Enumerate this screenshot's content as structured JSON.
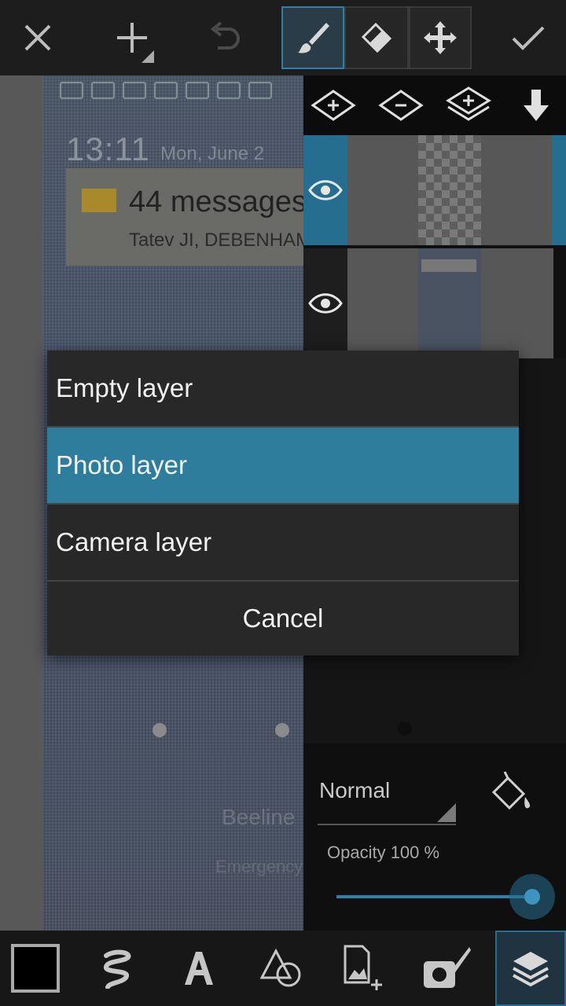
{
  "top_toolbar": {
    "icons": [
      "close-icon",
      "add-icon",
      "undo-icon",
      "brush-icon",
      "eraser-icon",
      "move-icon",
      "check-icon"
    ],
    "active_tool": "brush"
  },
  "canvas_photo": {
    "time": "13:11",
    "date": "Mon, June 2",
    "notification_title": "44 messages",
    "notification_sub": "Tatev JI, DEBENHAMS, ",
    "carrier": "Beeline",
    "emergency": "Emergency calls only"
  },
  "layers_panel": {
    "toolbar_icons": [
      "add-layer-icon",
      "remove-layer-icon",
      "merge-layers-icon",
      "move-layer-down-icon"
    ],
    "layers": [
      {
        "name": "transparent-layer",
        "visible": true,
        "selected": true
      },
      {
        "name": "photo-layer",
        "visible": true,
        "selected": false
      }
    ]
  },
  "blend_panel": {
    "mode": "Normal",
    "opacity_label": "Opacity  100 %",
    "opacity_value": 100
  },
  "dialog": {
    "items": [
      {
        "label": "Empty layer",
        "selected": false
      },
      {
        "label": "Photo layer",
        "selected": true
      },
      {
        "label": "Camera layer",
        "selected": false
      }
    ],
    "cancel_label": "Cancel"
  },
  "bottom_toolbar": {
    "icons": [
      "color-swatch",
      "lasso-icon",
      "text-icon",
      "shapes-icon",
      "add-image-icon",
      "camera-brush-icon",
      "layers-icon"
    ],
    "active": "layers-icon",
    "color": "#000000"
  },
  "colors": {
    "accent": "#2f7d9c",
    "dialog_bg": "#282828",
    "toolbar_bg": "#1d1d1d"
  }
}
